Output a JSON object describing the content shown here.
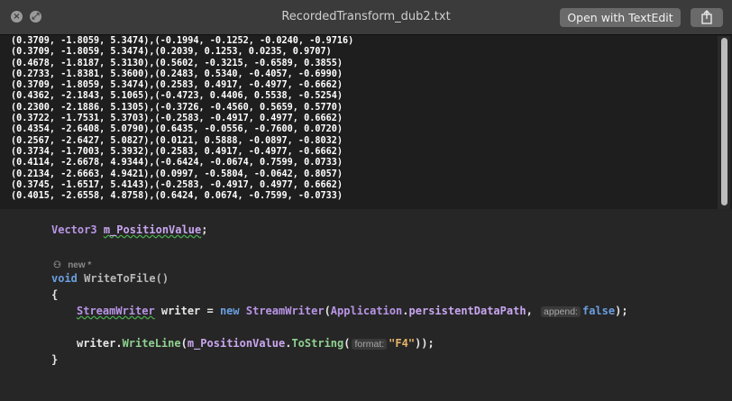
{
  "window": {
    "title": "RecordedTransform_dub2.txt",
    "open_button": "Open with TextEdit",
    "share_icon": "share-icon",
    "close_icon": "close-icon",
    "fullscreen_icon": "fullscreen-icon"
  },
  "file_lines": [
    "(0.3709, -1.8059, 5.3474),(-0.1994, -0.1252, -0.0240, -0.9716)",
    "(0.3709, -1.8059, 5.3474),(0.2039, 0.1253, 0.0235, 0.9707)",
    "(0.4678, -1.8187, 5.3130),(0.5602, -0.3215, -0.6589, 0.3855)",
    "(0.2733, -1.8381, 5.3600),(0.2483, 0.5340, -0.4057, -0.6990)",
    "(0.3709, -1.8059, 5.3474),(0.2583, 0.4917, -0.4977, -0.6662)",
    "(0.4362, -2.1843, 5.1065),(-0.4723, 0.4406, 0.5538, -0.5254)",
    "(0.2300, -2.1886, 5.1305),(-0.3726, -0.4560, 0.5659, 0.5770)",
    "(0.3722, -1.7531, 5.3703),(-0.2583, -0.4917, 0.4977, 0.6662)",
    "(0.4354, -2.6408, 5.0790),(0.6435, -0.0556, -0.7600, 0.0720)",
    "(0.2567, -2.6427, 5.0827),(0.0121, 0.5888, -0.0897, -0.8032)",
    "(0.3734, -1.7003, 5.3932),(0.2583, 0.4917, -0.4977, -0.6662)",
    "(0.4114, -2.6678, 4.9344),(-0.6424, -0.0674, 0.7599, 0.0733)",
    "(0.2134, -2.6663, 4.9421),(0.0997, -0.5804, -0.0642, 0.8057)",
    "(0.3745, -1.6517, 5.4143),(-0.2583, -0.4917, 0.4977, 0.6662)",
    "(0.4015, -2.6558, 4.8758),(0.6424, 0.0674, -0.7599, -0.0733)"
  ],
  "code": {
    "decl_type": "Vector3",
    "decl_field": "m_PositionValue",
    "decl_semicolon": ";",
    "usage_hint": "new *",
    "method_kw": "void",
    "method_name": "WriteToFile()",
    "open_brace": "{",
    "close_brace": "}",
    "line1_type": "StreamWriter",
    "line1_var": " writer = ",
    "line1_new": "new",
    "line1_type2": " StreamWriter",
    "line1_paren": "(",
    "line1_class": "Application",
    "line1_dot": ".",
    "line1_prop": "persistentDataPath",
    "line1_comma": ", ",
    "line1_hint": "append:",
    "line1_bool": "false",
    "line1_end": ");",
    "line2_obj": "writer.",
    "line2_method": "WriteLine",
    "line2_paren": "(",
    "line2_field": "m_PositionValue",
    "line2_dot": ".",
    "line2_method2": "ToString",
    "line2_paren2": "(",
    "line2_hint": "format:",
    "line2_str": "\"F4\"",
    "line2_end": "));"
  }
}
